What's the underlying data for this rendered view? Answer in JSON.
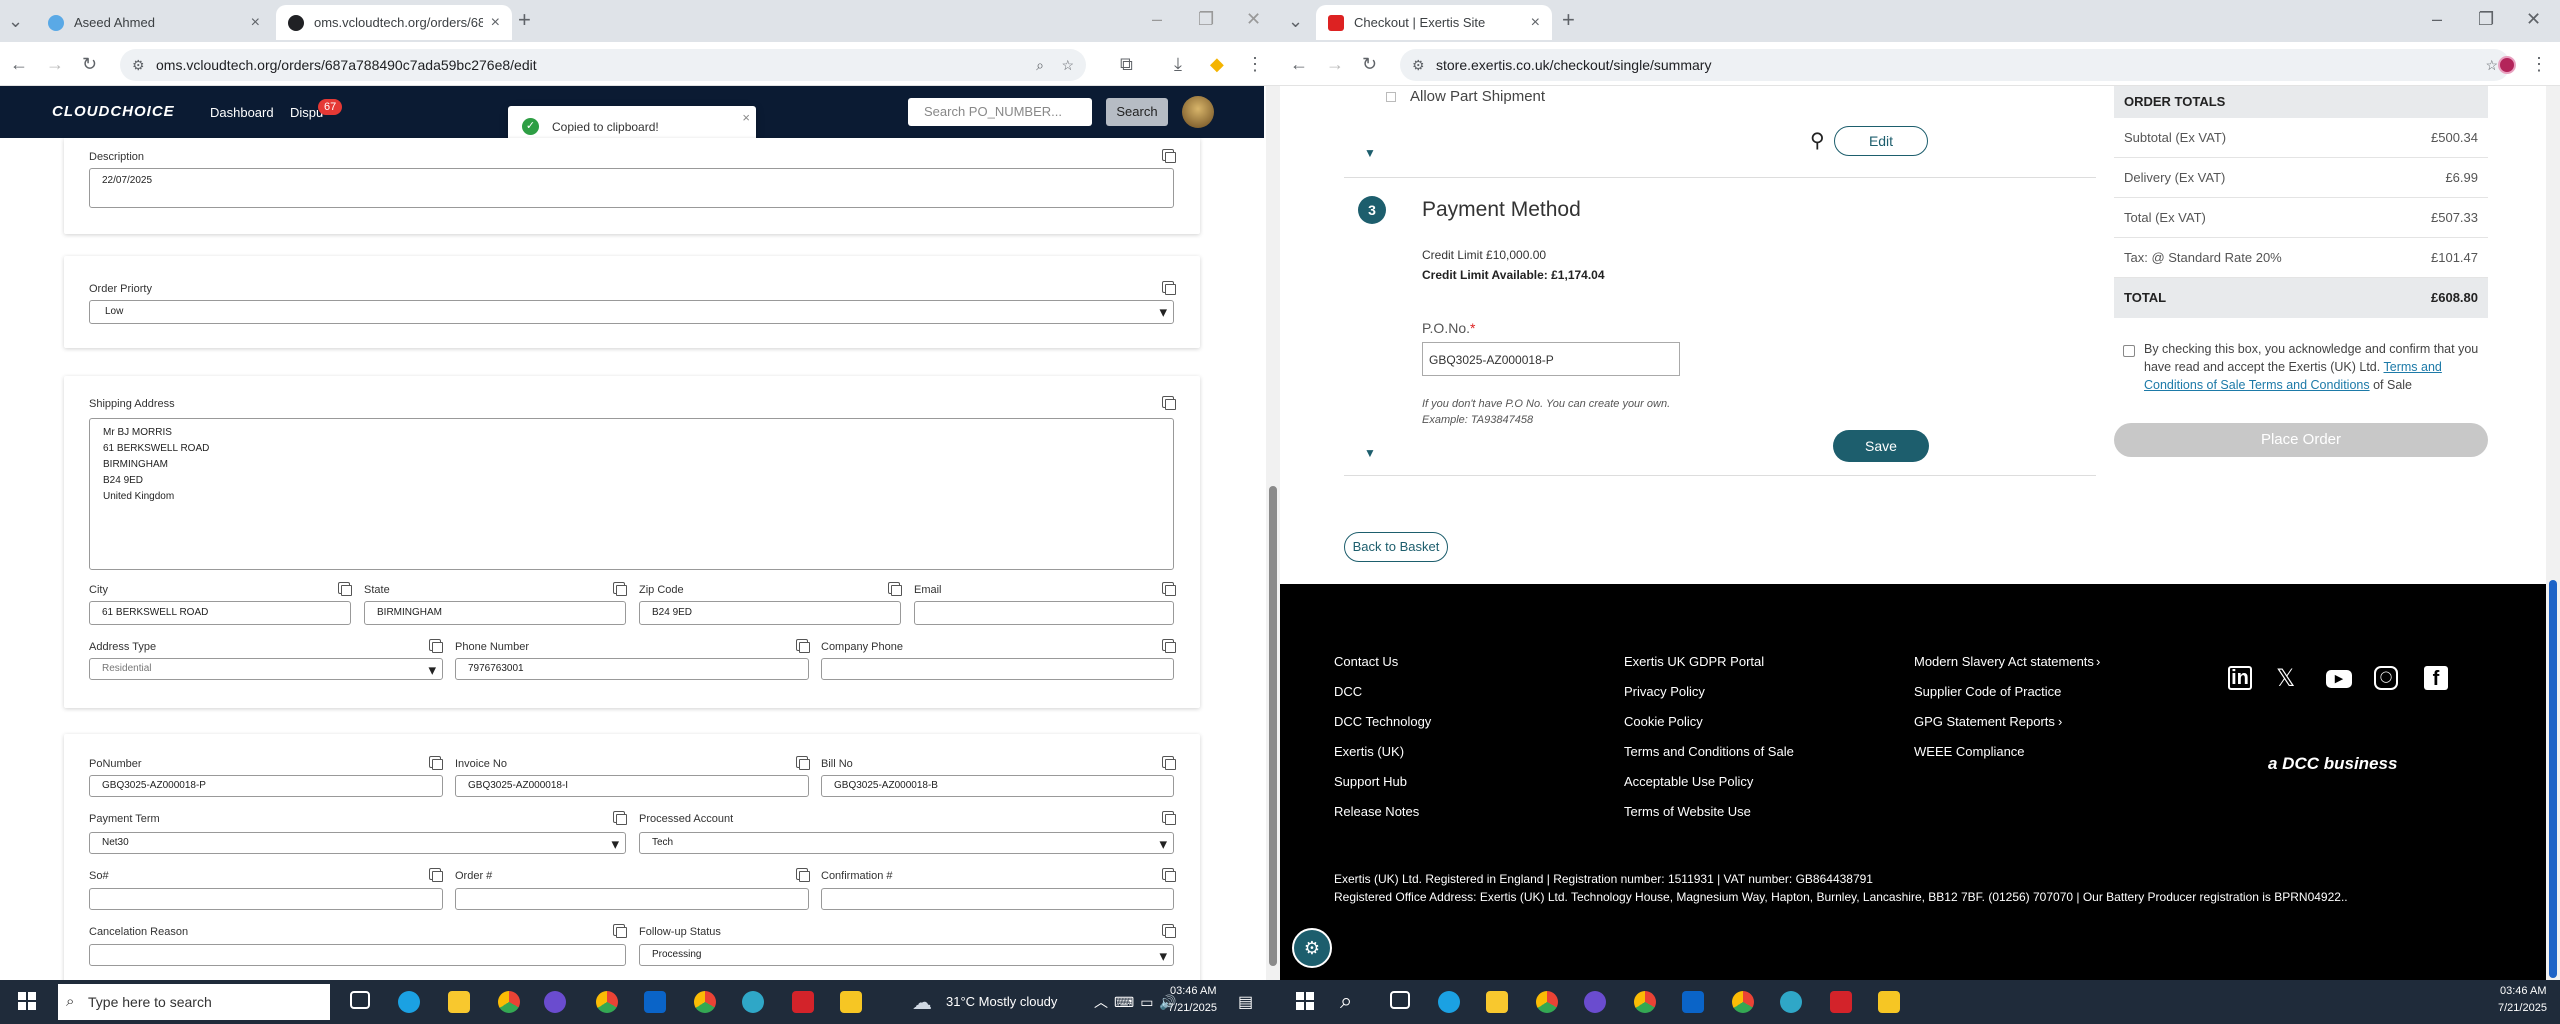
{
  "left_window": {
    "tabs": [
      {
        "label": "Aseed Ahmed"
      },
      {
        "label": "oms.vcloudtech.org/orders/687"
      }
    ],
    "url": "oms.vcloudtech.org/orders/687a788490c7ada59bc276e8/edit",
    "app": {
      "logo": "CLOUDCHOICE",
      "nav": [
        "Dashboard",
        "Dispu"
      ],
      "badge": "67",
      "search_placeholder": "Search PO_NUMBER...",
      "search_button": "Search"
    },
    "toast": "Copied to clipboard!",
    "description": {
      "label": "Description",
      "value": "22/07/2025"
    },
    "priority": {
      "label": "Order Priorty",
      "value": "Low"
    },
    "shipping": {
      "label": "Shipping Address",
      "lines": [
        "Mr BJ MORRIS",
        "61 BERKSWELL ROAD",
        "BIRMINGHAM",
        "B24 9ED",
        "United Kingdom"
      ]
    },
    "city": {
      "label": "City",
      "value": "61 BERKSWELL ROAD"
    },
    "state": {
      "label": "State",
      "value": "BIRMINGHAM"
    },
    "zip": {
      "label": "Zip Code",
      "value": "B24 9ED"
    },
    "email": {
      "label": "Email",
      "value": ""
    },
    "address_type": {
      "label": "Address Type",
      "value": "Residential"
    },
    "phone": {
      "label": "Phone Number",
      "value": "7976763001"
    },
    "company_phone": {
      "label": "Company Phone",
      "value": ""
    },
    "po_number": {
      "label": "PoNumber",
      "value": "GBQ3025-AZ000018-P"
    },
    "invoice_no": {
      "label": "Invoice No",
      "value": "GBQ3025-AZ000018-I"
    },
    "bill_no": {
      "label": "Bill No",
      "value": "GBQ3025-AZ000018-B"
    },
    "payment_term": {
      "label": "Payment Term",
      "value": "Net30"
    },
    "processed_account": {
      "label": "Processed Account",
      "value": "Tech"
    },
    "so": {
      "label": "So#",
      "value": ""
    },
    "order_no": {
      "label": "Order #",
      "value": ""
    },
    "confirmation": {
      "label": "Confirmation #",
      "value": ""
    },
    "cancel_reason": {
      "label": "Cancelation Reason",
      "value": ""
    },
    "followup": {
      "label": "Follow-up Status",
      "value": "Processing"
    }
  },
  "right_window": {
    "tabs": [
      {
        "label": "Checkout | Exertis Site"
      }
    ],
    "url": "store.exertis.co.uk/checkout/single/summary",
    "allow_part": "Allow Part Shipment",
    "edit": "Edit",
    "step": "3",
    "payment_title": "Payment Method",
    "credit_limit": "Credit Limit £10,000.00",
    "credit_available": "Credit Limit Available: £1,174.04",
    "po_label": "P.O.No.",
    "po_required": "*",
    "po_value": "GBQ3025-AZ000018-P",
    "po_hint1": "If you don't have P.O No. You can create your own.",
    "po_hint2": "Example: TA93847458",
    "save": "Save",
    "back": "Back to Basket",
    "totals": {
      "title": "ORDER TOTALS",
      "rows": [
        {
          "label": "Subtotal (Ex VAT)",
          "value": "£500.34"
        },
        {
          "label": "Delivery (Ex VAT)",
          "value": "£6.99"
        },
        {
          "label": "Total (Ex VAT)",
          "value": "£507.33"
        },
        {
          "label": "Tax: @ Standard Rate 20%",
          "value": "£101.47"
        },
        {
          "label": "TOTAL",
          "value": "£608.80"
        }
      ]
    },
    "terms_prefix": "By checking this box, you acknowledge and confirm that you have read and accept the Exertis (UK) Ltd.",
    "terms_link": "Terms and Conditions of Sale Terms and Conditions",
    "terms_suffix": "of Sale",
    "place_order": "Place Order",
    "footer": {
      "col1": [
        "Contact Us",
        "DCC",
        "DCC Technology",
        "Exertis (UK)",
        "Support Hub",
        "Release Notes"
      ],
      "col2": [
        "Exertis UK GDPR Portal",
        "Privacy Policy",
        "Cookie Policy",
        "Terms and Conditions of Sale",
        "Acceptable Use Policy",
        "Terms of Website Use"
      ],
      "col3": [
        "Modern Slavery Act statements",
        "Supplier Code of Practice",
        "GPG Statement Reports",
        "WEEE Compliance"
      ],
      "dcc": "a DCC business",
      "legal1": "Exertis (UK) Ltd. Registered in England | Registration number: 1511931 | VAT number: GB864438791",
      "legal2": "Registered Office Address: Exertis (UK) Ltd. Technology House, Magnesium Way, Hapton, Burnley, Lancashire, BB12 7BF. (01256) 707070 | Our Battery Producer registration is BPRN04922.."
    }
  },
  "taskbar_left": {
    "search": "Type here to search",
    "weather": "31°C  Mostly cloudy",
    "time": "03:46 AM",
    "date": "7/21/2025"
  },
  "taskbar_right": {
    "time": "03:46 AM",
    "date": "7/21/2025"
  }
}
